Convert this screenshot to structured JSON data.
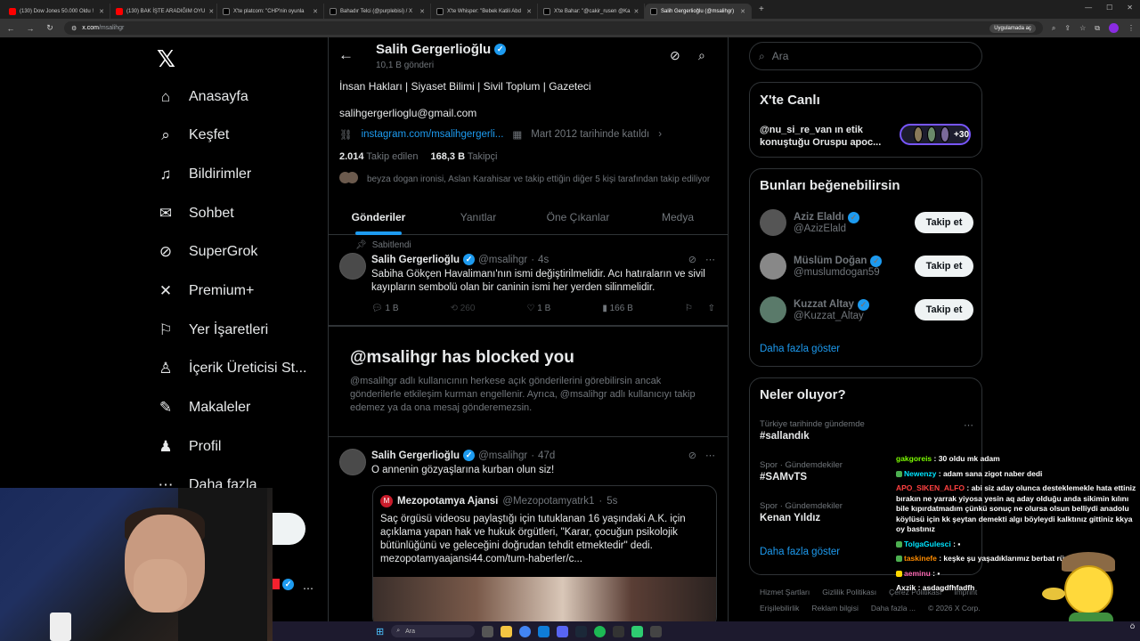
{
  "browser": {
    "tabs": [
      {
        "label": "(130) Dow Jones 50.000 Oldu !",
        "icon": "youtube-icon"
      },
      {
        "label": "(130) BAK İŞTE ARADIĞIM OYU",
        "icon": "youtube-icon"
      },
      {
        "label": "X'te platcom: \"CHP'nin oyunla",
        "icon": "x-icon"
      },
      {
        "label": "Bahadır Telci (@purplebisi) / X",
        "icon": "x-icon"
      },
      {
        "label": "X'te Whisper: \"Bebek Katili Abd",
        "icon": "x-icon"
      },
      {
        "label": "X'te Bahar: \"@cakir_rusen @Ka",
        "icon": "x-icon"
      },
      {
        "label": "Salih Gergerlioğlu (@msalihgr)",
        "icon": "x-icon",
        "active": true
      }
    ],
    "url_host": "x.com",
    "url_path": "/msalihgr",
    "app_chip": "Uygulamada aç"
  },
  "nav": {
    "items": [
      {
        "label": "Anasayfa",
        "icon": "home-icon",
        "glyph": "⌂"
      },
      {
        "label": "Keşfet",
        "icon": "search-icon",
        "glyph": "⌕"
      },
      {
        "label": "Bildirimler",
        "icon": "bell-icon",
        "glyph": "🔔︎"
      },
      {
        "label": "Sohbet",
        "icon": "mail-icon",
        "glyph": "✉"
      },
      {
        "label": "SuperGrok",
        "icon": "grok-icon",
        "glyph": "⊘"
      },
      {
        "label": "Premium+",
        "icon": "x-premium-icon",
        "glyph": "✕"
      },
      {
        "label": "Yer İşaretleri",
        "icon": "bookmark-icon",
        "glyph": "🔖︎"
      },
      {
        "label": "İçerik Üreticisi St...",
        "icon": "creator-studio-icon",
        "glyph": "♙"
      },
      {
        "label": "Makaleler",
        "icon": "articles-icon",
        "glyph": "✎"
      },
      {
        "label": "Profil",
        "icon": "profile-icon",
        "glyph": "♟"
      },
      {
        "label": "Daha fazla",
        "icon": "more-icon",
        "glyph": "⋯"
      }
    ]
  },
  "profile": {
    "name": "Salih Gergerlioğlu",
    "post_count": "10,1 B gönderi",
    "bio": "İnsan Hakları | Siyaset Bilimi | Sivil Toplum | Gazeteci",
    "email": "salihgergerlioglu@gmail.com",
    "link": "instagram.com/msalihgergerli...",
    "joined": "Mart 2012 tarihinde katıldı",
    "following_count": "2.014",
    "following_label": "Takip edilen",
    "followers_count": "168,3 B",
    "followers_label": "Takipçi",
    "mutual_text": "beyza dogan ironisi, Aslan Karahisar ve takip ettiğin diğer 5 kişi tarafından takip ediliyor"
  },
  "tabs": [
    {
      "label": "Gönderiler",
      "active": true
    },
    {
      "label": "Yanıtlar"
    },
    {
      "label": "Öne Çıkanlar"
    },
    {
      "label": "Medya"
    }
  ],
  "tweets": {
    "pinned_label": "Sabitlendi",
    "t1": {
      "name": "Salih Gergerlioğlu",
      "handle": "@msalihgr",
      "time": "4s",
      "text": "Sabiha Gökçen Havalimanı'nın ismi değiştirilmelidir. Acı hatıraların ve sivil kayıpların sembolü olan bir caninin ismi her yerden silinmelidir.",
      "replies": "1 B",
      "reposts": "260",
      "likes": "1 B",
      "views": "166 B"
    },
    "t2": {
      "name": "Salih Gergerlioğlu",
      "handle": "@msalihgr",
      "time": "47d",
      "text": "O annenin gözyaşlarına kurban olun siz!"
    },
    "quote": {
      "name": "Mezopotamya Ajansi",
      "handle": "@Mezopotamyatrk1",
      "time": "5s",
      "text": "Saç örgüsü videosu paylaştığı için tutuklanan 16 yaşındaki A.K. için açıklama yapan hak ve hukuk örgütleri, \"Karar, çocuğun psikolojik bütünlüğünü ve geleceğini doğrudan tehdit etmektedir\" dedi. mezopotamyaajansi44.com/tum-haberler/c..."
    }
  },
  "blocked": {
    "title": "@msalihgr has blocked you",
    "text": "@msalihgr adlı kullanıcının herkese açık gönderilerini görebilirsin ancak gönderilerle etkileşim kurman engellenir. Ayrıca, @msalihgr adlı kullanıcıyı takip edemez ya da ona mesaj gönderemezsin."
  },
  "sidebar": {
    "search_placeholder": "Ara",
    "live": {
      "title": "X'te Canlı",
      "text": "@nu_si_re_van ın etik konuştuğu Oruspu apoc...",
      "count": "+30"
    },
    "suggest_title": "Bunları beğenebilirsin",
    "suggestions": [
      {
        "name": "Aziz Elaldı",
        "handle": "@AzizElald"
      },
      {
        "name": "Müslüm Doğan",
        "handle": "@muslumdogan59"
      },
      {
        "name": "Kuzzat Altay",
        "handle": "@Kuzzat_Altay"
      }
    ],
    "follow_label": "Takip et",
    "show_more": "Daha fazla göster",
    "trends_title": "Neler oluyor?",
    "trends": [
      {
        "context": "Türkiye tarihinde gündemde",
        "name": "#sallandık"
      },
      {
        "context": "Spor · Gündemdekiler",
        "name": "#SAMvTS"
      },
      {
        "context": "Spor · Gündemdekiler",
        "name": "Kenan Yıldız"
      }
    ],
    "footer": [
      "Hizmet Şartları",
      "Gizlilik Politikası",
      "Çerez Politikası",
      "Imprint",
      "Erişilebilirlik",
      "Reklam bilgisi",
      "Daha fazla ...",
      "© 2026 X Corp."
    ]
  },
  "chat": [
    {
      "user": "gakgoreis",
      "msg": "30 oldu mk adam",
      "color": "u-green"
    },
    {
      "user": "Newenzy",
      "msg": "adam sana zigot naber dedi",
      "color": "u-cyan"
    },
    {
      "user": "APO_SIKEN_ALFO",
      "msg": "abi siz aday olunca desteklemekle hata ettiniz bırakın ne yarrak yiyosa yesin aq aday olduğu anda sikimin kılını bile kıpırdatmadım çünkü sonuç ne olursa olsun belliydi anadolu köylüsü için kk şeytan demekti algı böyleydi kalktınız gittiniz kkya oy bastınız",
      "color": "u-red"
    },
    {
      "user": "TolgaGulesci",
      "msg": "",
      "color": "u-cyan"
    },
    {
      "user": "taskinefe",
      "msg": "keşke şu yaşadıklarımız berbat rüya olsaydı...",
      "color": "u-orange"
    },
    {
      "user": "aeminu",
      "msg": "",
      "color": "u-pink"
    },
    {
      "user": "Axzik",
      "msg": "asdagdfhfadfh",
      "color": "u-white"
    }
  ],
  "taskbar": {
    "search": "Ara",
    "time": "Ö"
  }
}
